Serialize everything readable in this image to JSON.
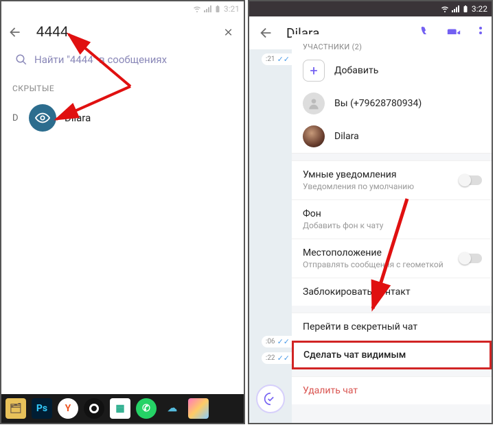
{
  "left": {
    "status_time": "3:21",
    "search_value": "4444",
    "find_line": "Найти \"4444\" в сообщениях",
    "hidden_header": "СКРЫТЫЕ",
    "contact": {
      "letter": "D",
      "name": "Dilara"
    }
  },
  "right": {
    "status_time": "3:22",
    "title": "Dilara",
    "participants_header": "УЧАСТНИКИ (2)",
    "add_label": "Добавить",
    "you_label": "Вы (+79628780934)",
    "contact_name": "Dilara",
    "bubble_times": [
      ":21",
      ":06",
      ":22"
    ],
    "settings": {
      "smart_title": "Умные уведомления",
      "smart_sub": "Уведомления по умолчанию",
      "bg_title": "Фон",
      "bg_sub": "Добавить фон к чату",
      "loc_title": "Местоположение",
      "loc_sub": "Отправлять сообщения с геометкой",
      "block": "Заблокировать контакт",
      "secret": "Перейти в секретный чат",
      "make_visible": "Сделать чат видимым",
      "delete": "Удалить чат"
    }
  }
}
